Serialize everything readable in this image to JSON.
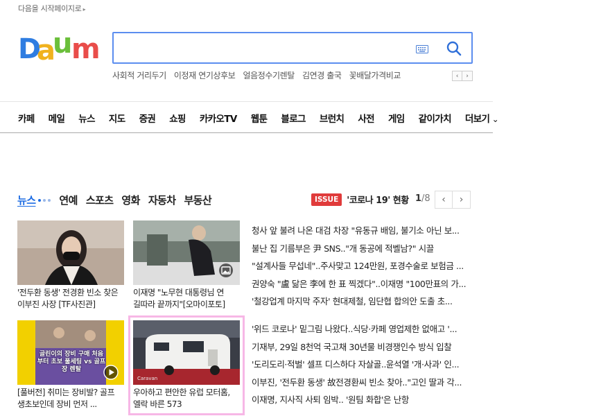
{
  "top_link": "다음을 시작페이지로",
  "logo_text": "Daum",
  "search": {
    "value": "",
    "placeholder": ""
  },
  "keywords": [
    "사회적 거리두기",
    "이정재 연기상후보",
    "얼음정수기렌탈",
    "김연경 출국",
    "꽃배달가격비교"
  ],
  "gnb": [
    "카페",
    "메일",
    "뉴스",
    "지도",
    "증권",
    "쇼핑",
    "카카오TV",
    "웹툰",
    "블로그",
    "브런치",
    "사전",
    "게임",
    "같이가치",
    "더보기"
  ],
  "news_tabs": [
    "뉴스",
    "연예",
    "스포츠",
    "영화",
    "자동차",
    "부동산"
  ],
  "issue": {
    "badge": "ISSUE",
    "text": "'코로나 19' 현황",
    "page": "1",
    "total": "/8"
  },
  "cards": [
    {
      "caption": "'전두환 동생' 전경환 빈소 찾은 이부진 사장 [TF사진관]"
    },
    {
      "caption": "이재명 \"노무현 대통령님 연 길따라 끝까지\"[오마이포토]"
    },
    {
      "caption": "[풀버전] 취미는 장비발? 골프 생초보인데 장비 먼저 ...",
      "overlay": "골린이의 장비 구매 처음부터 초보 풀세팅 vs 골프장 렌탈"
    },
    {
      "caption": "우아하고 편안한 유럽 모터홈, 엘락 바른 573",
      "overlay": "Caravan"
    }
  ],
  "headlines_top": [
    "청사 앞 불려 나온 대검 차장 \"유동규 배임, 불기소 아닌 보...",
    "불난 집 기름부은 尹 SNS..\"개 동공에 적벨남?\" 시끌",
    "\"설계사들 무섭네\"..주사맞고 124만원, 포경수술로 보험금 ...",
    "권양숙 \"盧 닮은 李에 한 표 찍겠다\"..이재명 \"100만표의 가...",
    "'철강업계 마지막 주자' 현대제철, 임단협 합의안 도출 초..."
  ],
  "headlines_bottom": [
    "'위드 코로나' 밑그림 나왔다..식당·카페 영업제한 없애고 '...",
    "기재부, 29일 8천억 국고채 30년물 비경쟁인수 방식 입찰",
    "'도리도리·적벌' 셀프 디스하다 자살골..윤석열 '개·사과' 인...",
    "이부진, '전두환 동생' 故전경환씨 빈소 찾아..\"고인 딸과 각...",
    "이재명, 지사직 사퇴 임박.. '원팀 화합'은 난항"
  ],
  "colors": {
    "accent": "#1d6ce3",
    "issue_badge": "#e03b3b",
    "search_border": "#5b8def",
    "selection": "#f7b7e6"
  }
}
